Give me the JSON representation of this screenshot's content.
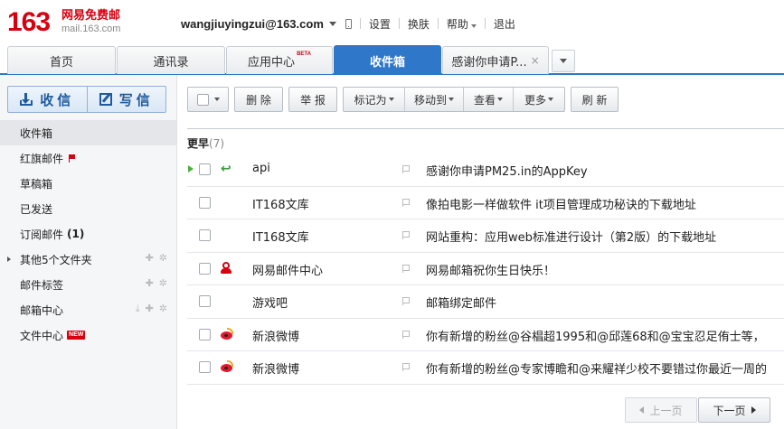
{
  "brand": {
    "logo_number": "163",
    "logo_title": "网易免费邮",
    "logo_domain": "mail.163.com",
    "accent_color": "#d7000f",
    "tab_active_color": "#2e77c9"
  },
  "header": {
    "user_email": "wangjiuyingzui@163.com",
    "links": {
      "settings": "设置",
      "skin": "换肤",
      "help": "帮助",
      "logout": "退出"
    }
  },
  "tabs": [
    {
      "label": "首页"
    },
    {
      "label": "通讯录"
    },
    {
      "label": "应用中心",
      "badge": "BETA"
    },
    {
      "label": "收件箱",
      "active": true
    },
    {
      "label": "感谢你申请P...",
      "closable": true
    }
  ],
  "sidebar": {
    "receive_label": "收信",
    "write_label": "写信",
    "folders": [
      {
        "label": "收件箱",
        "active": true
      },
      {
        "label": "红旗邮件",
        "icon": "red-flag-icon"
      },
      {
        "label": "草稿箱"
      },
      {
        "label": "已发送"
      },
      {
        "label": "订阅邮件",
        "count": "(1)"
      },
      {
        "label": "其他5个文件夹",
        "expandable": true
      },
      {
        "label": "邮件标签"
      },
      {
        "label": "邮箱中心"
      },
      {
        "label": "文件中心",
        "badge": "NEW"
      }
    ]
  },
  "toolbar": {
    "delete": "删 除",
    "report": "举 报",
    "mark_as": "标记为",
    "move_to": "移动到",
    "view": "查看",
    "more": "更多",
    "refresh": "刷 新"
  },
  "mail_group": {
    "title": "更早",
    "count": "(7)"
  },
  "mails": [
    {
      "sender": "api",
      "subject": "感谢你申请PM25.in的AppKey",
      "icon": "replied-icon",
      "current": true
    },
    {
      "sender": "IT168文库",
      "subject": "像拍电影一样做软件 it项目管理成功秘诀的下载地址",
      "icon": ""
    },
    {
      "sender": "IT168文库",
      "subject": "网站重构：应用web标准进行设计（第2版）的下载地址",
      "icon": ""
    },
    {
      "sender": "网易邮件中心",
      "subject": "网易邮箱祝你生日快乐！",
      "icon": "163-mail-center-icon"
    },
    {
      "sender": "游戏吧",
      "subject": "邮箱绑定邮件",
      "icon": ""
    },
    {
      "sender": "新浪微博",
      "subject": "你有新增的粉丝@谷椙超1995和@邱莲68和@宝宝忍足侑士等，",
      "icon": "weibo-icon"
    },
    {
      "sender": "新浪微博",
      "subject": "你有新增的粉丝@专家博瞻和@来耀祥少校不要错过你最近一周的",
      "icon": "weibo-icon"
    }
  ],
  "pagination": {
    "prev": "上一页",
    "next": "下一页"
  }
}
